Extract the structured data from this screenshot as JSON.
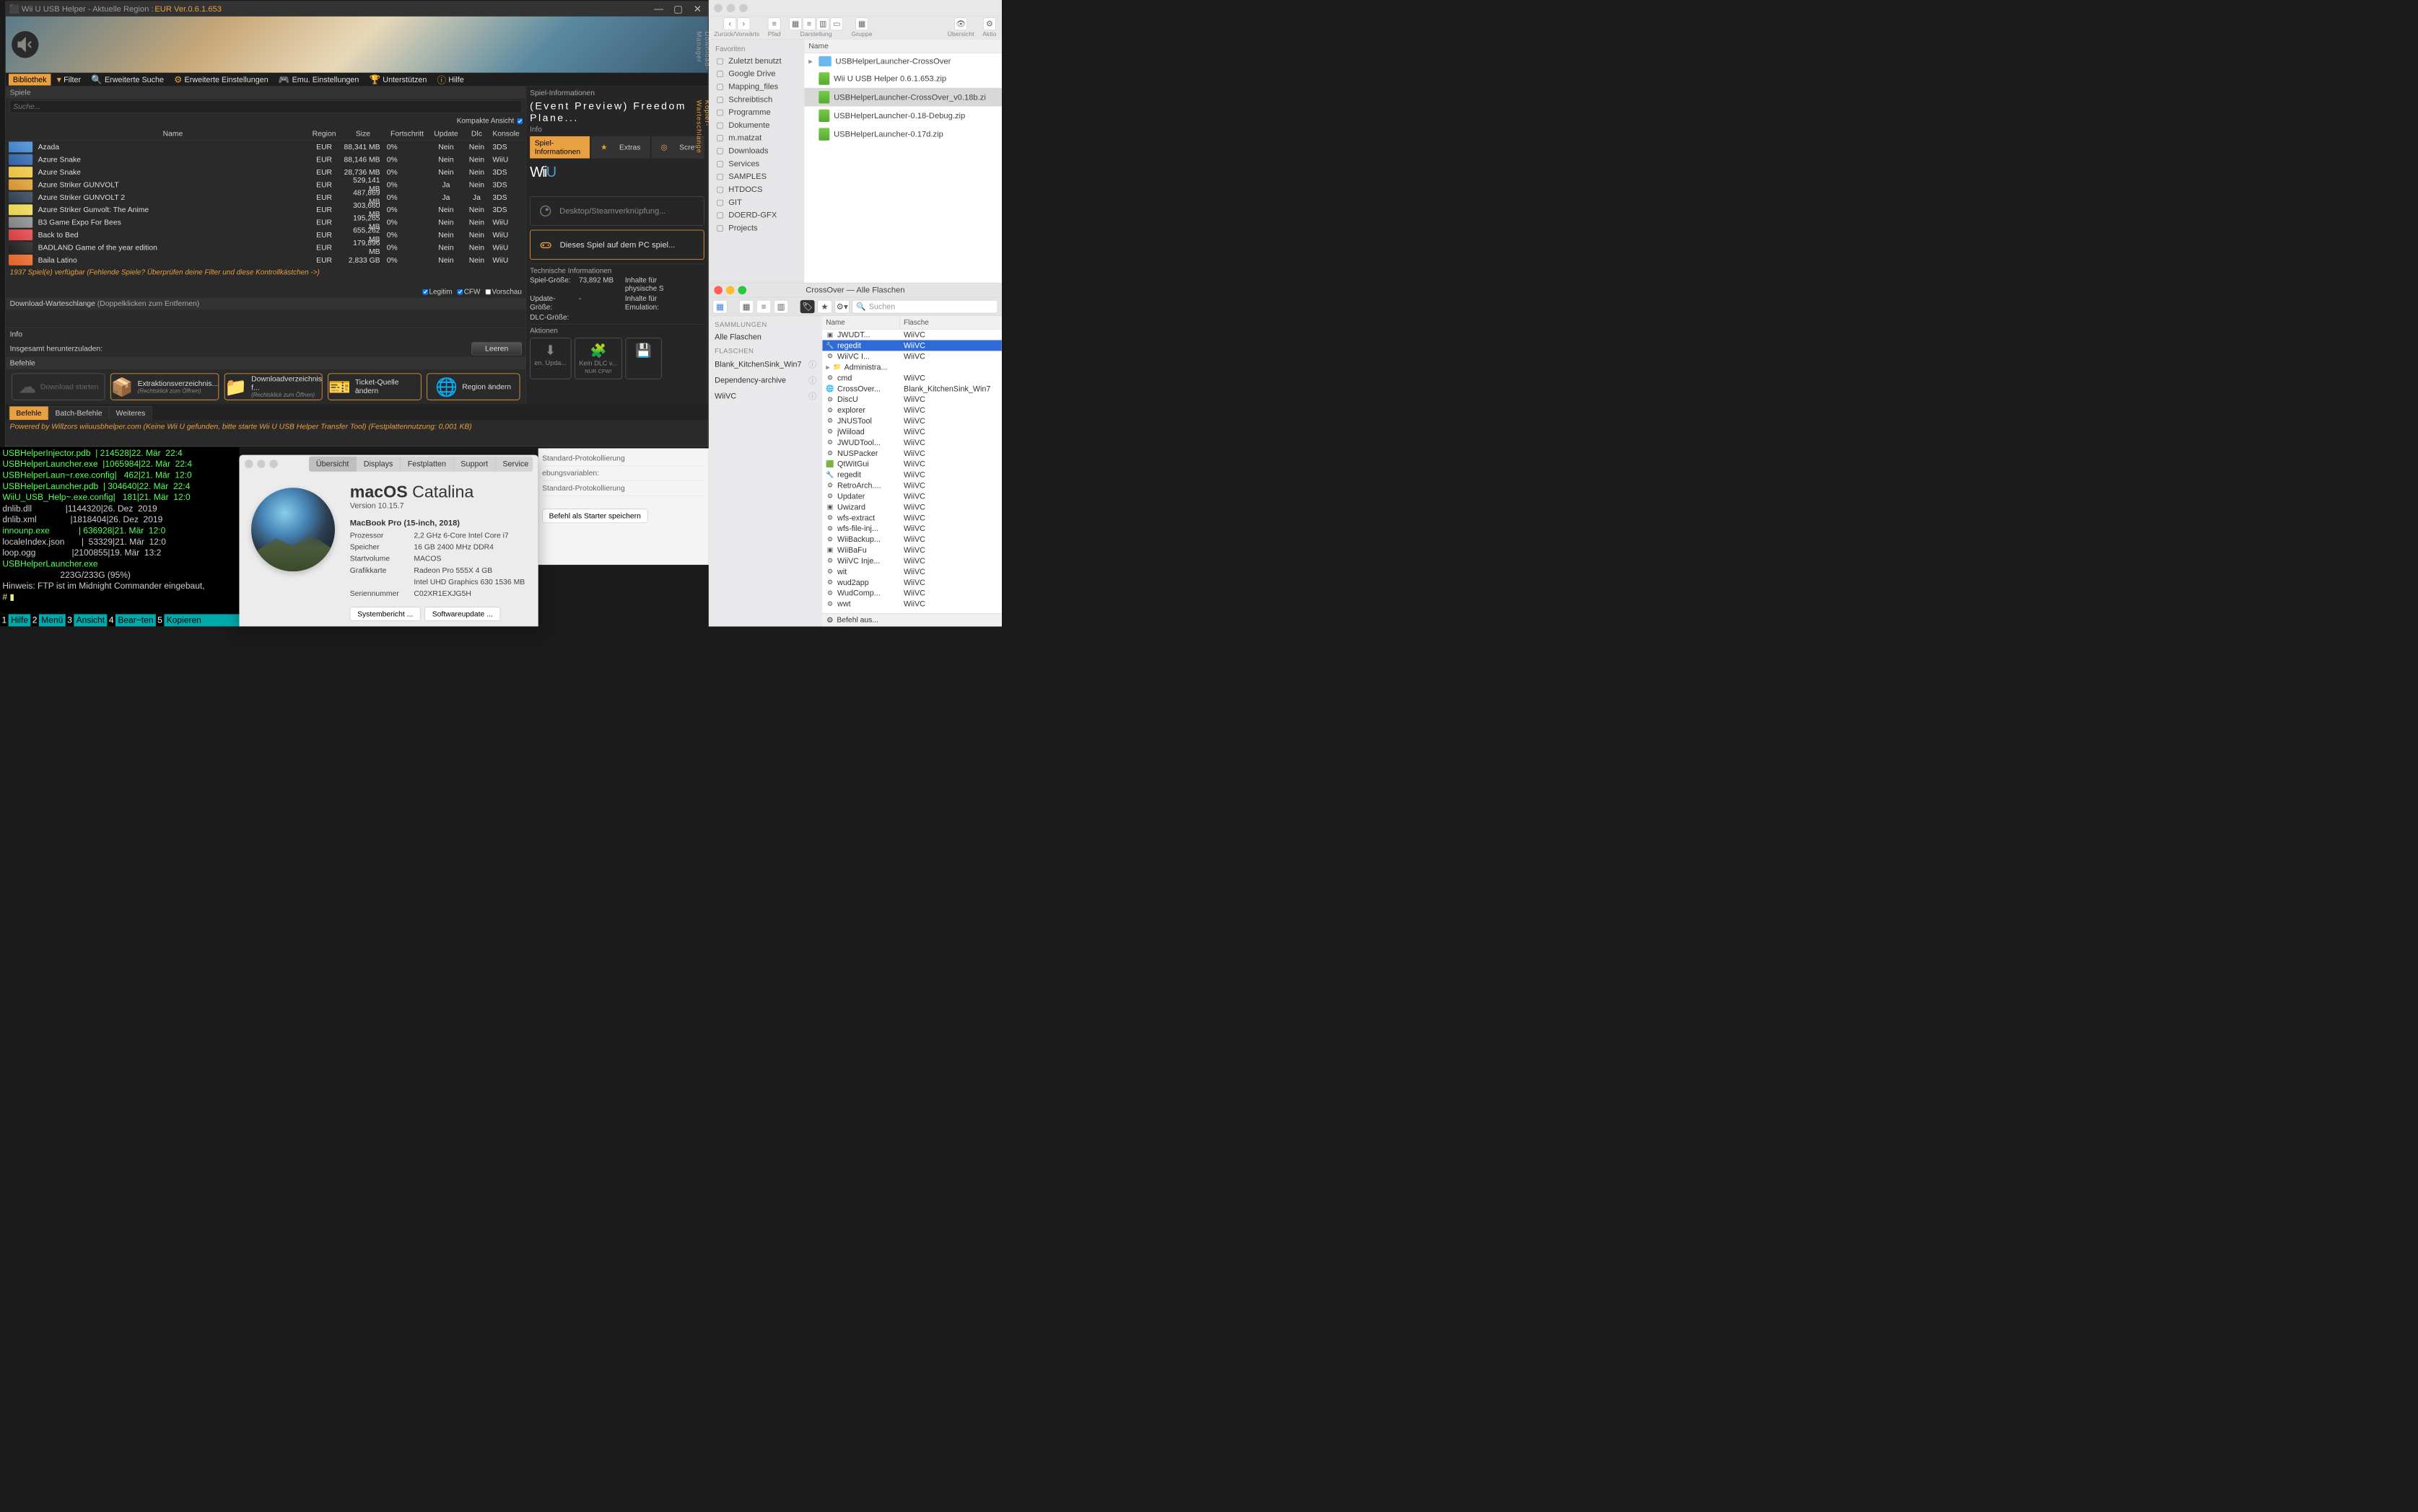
{
  "wiiu": {
    "title_prefix": "Wii U USB Helper - Aktuelle Region : ",
    "title_region": "EUR Ver.0.6.1.653",
    "dm_label": "Download-Manager",
    "kw_label": "Kopier-Warteschlange",
    "toolbar": {
      "bibliothek": "Bibliothek",
      "filter": "Filter",
      "suche": "Erweiterte Suche",
      "einstellungen": "Erweiterte Einstellungen",
      "emu": "Emu. Einstellungen",
      "unterstuetzen": "Unterstützen",
      "hilfe": "Hilfe"
    },
    "spiele": "Spiele",
    "search_placeholder": "Suche...",
    "kompakte": "Kompakte Ansicht",
    "headers": {
      "name": "Name",
      "region": "Region",
      "size": "Size",
      "fortschritt": "Fortschritt",
      "update": "Update",
      "dlc": "Dlc",
      "konsole": "Konsole"
    },
    "games": [
      {
        "name": "Azada",
        "region": "EUR",
        "size": "88,341 MB",
        "progress": "0%",
        "update": "Nein",
        "dlc": "Nein",
        "console": "3DS"
      },
      {
        "name": "Azure Snake",
        "region": "EUR",
        "size": "88,146 MB",
        "progress": "0%",
        "update": "Nein",
        "dlc": "Nein",
        "console": "WiiU"
      },
      {
        "name": "Azure Snake",
        "region": "EUR",
        "size": "28,736 MB",
        "progress": "0%",
        "update": "Nein",
        "dlc": "Nein",
        "console": "3DS"
      },
      {
        "name": "Azure Striker GUNVOLT",
        "region": "EUR",
        "size": "529,141 MB",
        "progress": "0%",
        "update": "Ja",
        "dlc": "Nein",
        "console": "3DS"
      },
      {
        "name": "Azure Striker GUNVOLT 2",
        "region": "EUR",
        "size": "487,869 MB",
        "progress": "0%",
        "update": "Ja",
        "dlc": "Ja",
        "console": "3DS"
      },
      {
        "name": "Azure Striker Gunvolt: The Anime",
        "region": "EUR",
        "size": "303,660 MB",
        "progress": "0%",
        "update": "Nein",
        "dlc": "Nein",
        "console": "3DS"
      },
      {
        "name": "B3 Game Expo For Bees",
        "region": "EUR",
        "size": "195,265 MB",
        "progress": "0%",
        "update": "Nein",
        "dlc": "Nein",
        "console": "WiiU"
      },
      {
        "name": "Back to Bed",
        "region": "EUR",
        "size": "655,262 MB",
        "progress": "0%",
        "update": "Nein",
        "dlc": "Nein",
        "console": "WiiU"
      },
      {
        "name": "BADLAND Game of the year edition",
        "region": "EUR",
        "size": "179,896 MB",
        "progress": "0%",
        "update": "Nein",
        "dlc": "Nein",
        "console": "WiiU"
      },
      {
        "name": "Baila Latino",
        "region": "EUR",
        "size": "2,833 GB",
        "progress": "0%",
        "update": "Nein",
        "dlc": "Nein",
        "console": "WiiU"
      }
    ],
    "hint": "1937 Spiel(e) verfügbar (Fehlende Spiele? Überprüfen  deine Filter  und diese  Kontrollkästchen  ->)",
    "checks": {
      "legitim": "Legitim",
      "cfw": "CFW",
      "vorschau": "Vorschau"
    },
    "dlq": "Download-Warteschlange",
    "dlq_hint": "(Doppelklicken zum Entfernen)",
    "info_label": "Info",
    "ins_label": "Insgesamt herunterzuladen:",
    "leeren": "Leeren",
    "befehle": "Befehle",
    "cmds": {
      "download": "Download starten",
      "extract": "Extraktionsverzeichnis...",
      "extract_sub": "(Rechtsklick zum Öffnen)",
      "dlverz": "Downloadverzeichnis f...",
      "dlverz_sub": "(Rechtsklick zum Öffnen)",
      "ticket": "Ticket-Quelle ändern",
      "region": "Region ändern"
    },
    "footer_tabs": {
      "befehle": "Befehle",
      "batch": "Batch-Befehle",
      "weiteres": "Weiteres"
    },
    "footer_status": "Powered by Willzors wiiuusbhelper.com (Keine Wii U gefunden, bitte starte Wii U USB Helper Transfer Tool)  (Festplattennutzung: 0,001 KB)",
    "right": {
      "si": "Spiel-Informationen",
      "game_title": "(Event Preview) Freedom Plane...",
      "info": "Info",
      "tabs": {
        "si": "Spiel-Informationen",
        "extras": "Extras",
        "scre": "Scre"
      },
      "logo": "Wii",
      "btn1": "Desktop/Steamverknüpfung...",
      "btn2": "Dieses Spiel auf dem PC spiel...",
      "ti": "Technische Informationen",
      "ti_rows": {
        "sg": "Spiel-Größe:",
        "sg_v": "73,892 MB",
        "ug": "Update-Größe:",
        "ug_v": "-",
        "dg": "DLC-Größe:",
        "dg_v": "",
        "phy": "Inhalte für physische S",
        "emu": "Inhalte für Emulation:"
      },
      "aktionen": "Aktionen",
      "ak1": "en. Upda...",
      "ak2": "Kein DLC v...",
      "ak2b": "NUR CFW!"
    }
  },
  "terminal": {
    "lines": [
      {
        "c": "g",
        "t": "USBHelperInjector.pdb  | 214528|22. Mär  22:4"
      },
      {
        "c": "g",
        "t": "USBHelperLauncher.exe  |1065984|22. Mär  22:4"
      },
      {
        "c": "g",
        "t": "USBHelperLaun~r.exe.config|   462|21. Mär  12:0"
      },
      {
        "c": "g",
        "t": "USBHelperLauncher.pdb  | 304640|22. Mär  22:4"
      },
      {
        "c": "g",
        "t": "WiiU_USB_Help~.exe.config|   181|21. Mär  12:0"
      },
      {
        "c": "w",
        "t": "dnlib.dll              |1144320|26. Dez  2019"
      },
      {
        "c": "w",
        "t": "dnlib.xml              |1818404|26. Dez  2019"
      },
      {
        "c": "g",
        "t": "innounp.exe            | 636928|21. Mär  12:0"
      },
      {
        "c": "w",
        "t": "localeIndex.json       |  53329|21. Mär  12:0"
      },
      {
        "c": "w",
        "t": "loop.ogg               |2100855|19. Mär  13:2"
      },
      {
        "c": "g",
        "t": ""
      },
      {
        "c": "g",
        "t": "USBHelperLauncher.exe"
      },
      {
        "c": "w",
        "t": "                        223G/233G (95%)"
      },
      {
        "c": "w",
        "t": "Hinweis: FTP ist im Midnight Commander eingebaut,"
      },
      {
        "c": "y",
        "t": "# ▮"
      }
    ],
    "bottom": [
      "1",
      "Hilfe",
      "2",
      "Menü",
      "3",
      "Ansicht",
      "4",
      "Bear~ten",
      "5",
      "Kopieren"
    ]
  },
  "about": {
    "tabs": [
      "Übersicht",
      "Displays",
      "Festplatten",
      "Support",
      "Service"
    ],
    "os_bold": "macOS",
    "os_light": " Catalina",
    "version": "Version 10.15.7",
    "model": "MacBook Pro (15-inch, 2018)",
    "specs": [
      [
        "Prozessor",
        "2,2 GHz 6-Core Intel Core i7"
      ],
      [
        "Speicher",
        "16 GB 2400 MHz DDR4"
      ],
      [
        "Startvolume",
        "MACOS"
      ],
      [
        "Grafikkarte",
        "Radeon Pro 555X 4 GB"
      ],
      [
        "",
        "Intel UHD Graphics 630 1536 MB"
      ],
      [
        "Seriennummer",
        "C02XR1EXJG5H"
      ]
    ],
    "btn1": "Systembericht ...",
    "btn2": "Softwareupdate ..."
  },
  "bgwin": {
    "l1": "Standard-Protokollierung",
    "l2": "ebungsvariablen:",
    "l3": "Standard-Protokollierung",
    "btn": "Befehl als Starter speichern"
  },
  "finder": {
    "tb": {
      "back": "Zurück/Vorwärts",
      "pfad": "Pfad",
      "darstellung": "Darstellung",
      "gruppe": "Gruppe",
      "uebersicht": "Übersicht",
      "aktionen": "Aktio"
    },
    "fav": "Favoriten",
    "sidebar": [
      "Zuletzt benutzt",
      "Google Drive",
      "Mapping_files",
      "Schreibtisch",
      "Programme",
      "Dokumente",
      "m.matzat",
      "Downloads",
      "Services",
      "SAMPLES",
      "HTDOCS",
      "GIT",
      "DOERD-GFX",
      "Projects"
    ],
    "header": "Name",
    "rows": [
      {
        "t": "folder",
        "name": "USBHelperLauncher-CrossOver",
        "arrow": true
      },
      {
        "t": "zip",
        "name": "Wii U USB Helper 0.6.1.653.zip"
      },
      {
        "t": "zip",
        "name": "USBHelperLauncher-CrossOver_v0.18b.zi",
        "sel": true
      },
      {
        "t": "zip",
        "name": "USBHelperLauncher-0.18-Debug.zip"
      },
      {
        "t": "zip",
        "name": "USBHelperLauncher-0.17d.zip"
      }
    ]
  },
  "crossover": {
    "title": "CrossOver — Alle Flaschen",
    "search_placeholder": "Suchen",
    "sidebar": {
      "samm": "SAMMLUNGEN",
      "alle": "Alle Flaschen",
      "flaschen": "FLASCHEN",
      "items": [
        "Blank_KitchenSink_Win7",
        "Dependency-archive",
        "WiiVC"
      ]
    },
    "headers": {
      "name": "Name",
      "flasche": "Flasche"
    },
    "rows": [
      {
        "ic": "app",
        "name": "JWUDT...",
        "flasche": "WiiVC"
      },
      {
        "ic": "reg",
        "name": "regedit",
        "flasche": "WiiVC",
        "sel": true
      },
      {
        "ic": "gear",
        "name": "WiiVC I...",
        "flasche": "WiiVC"
      },
      {
        "ic": "folder",
        "name": "Administra...",
        "flasche": "",
        "arrow": true
      },
      {
        "ic": "gear",
        "name": "cmd",
        "flasche": "WiiVC"
      },
      {
        "ic": "ie",
        "name": "CrossOver...",
        "flasche": "Blank_KitchenSink_Win7"
      },
      {
        "ic": "gear",
        "name": "DiscU",
        "flasche": "WiiVC"
      },
      {
        "ic": "gear",
        "name": "explorer",
        "flasche": "WiiVC"
      },
      {
        "ic": "gear",
        "name": "JNUSTool",
        "flasche": "WiiVC"
      },
      {
        "ic": "gear",
        "name": "jWiiload",
        "flasche": "WiiVC"
      },
      {
        "ic": "gear",
        "name": "JWUDTool...",
        "flasche": "WiiVC"
      },
      {
        "ic": "gear",
        "name": "NUSPacker",
        "flasche": "WiiVC"
      },
      {
        "ic": "qt",
        "name": "QtWitGui",
        "flasche": "WiiVC"
      },
      {
        "ic": "reg",
        "name": "regedit",
        "flasche": "WiiVC"
      },
      {
        "ic": "gear",
        "name": "RetroArch....",
        "flasche": "WiiVC"
      },
      {
        "ic": "gear",
        "name": "Updater",
        "flasche": "WiiVC"
      },
      {
        "ic": "app",
        "name": "Uwizard",
        "flasche": "WiiVC"
      },
      {
        "ic": "gear",
        "name": "wfs-extract",
        "flasche": "WiiVC"
      },
      {
        "ic": "gear",
        "name": "wfs-file-inj...",
        "flasche": "WiiVC"
      },
      {
        "ic": "gear",
        "name": "WiiBackup...",
        "flasche": "WiiVC"
      },
      {
        "ic": "app",
        "name": "WiiBaFu",
        "flasche": "WiiVC"
      },
      {
        "ic": "gear",
        "name": "WiiVC Inje...",
        "flasche": "WiiVC"
      },
      {
        "ic": "gear",
        "name": "wit",
        "flasche": "WiiVC"
      },
      {
        "ic": "gear",
        "name": "wud2app",
        "flasche": "WiiVC"
      },
      {
        "ic": "gear",
        "name": "WudComp...",
        "flasche": "WiiVC"
      },
      {
        "ic": "gear",
        "name": "wwt",
        "flasche": "WiiVC"
      }
    ],
    "footer": "Befehl aus..."
  }
}
